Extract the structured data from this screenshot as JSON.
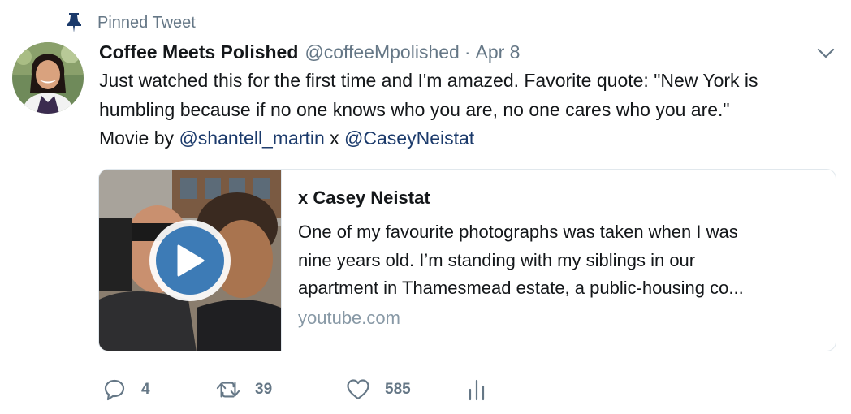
{
  "pinned": {
    "label": "Pinned Tweet",
    "icon": "pin-icon"
  },
  "author": {
    "display_name": "Coffee Meets Polished",
    "handle": "@coffeeMpolished",
    "separator": "·",
    "timestamp": "Apr 8"
  },
  "tweet": {
    "line1": "Just watched this for the first time and I'm amazed. Favorite quote: \"New York is",
    "line2": "humbling because if no one knows who you are, no one cares who you are.\"",
    "line3_prefix": "Movie by ",
    "mention1": "@shantell_martin",
    "line3_mid": " x ",
    "mention2": "@CaseyNeistat"
  },
  "card": {
    "title": "x Casey Neistat",
    "desc_line1": "One of my favourite photographs was taken when I was",
    "desc_line2": "nine years old. I’m standing with my siblings in our",
    "desc_line3": "apartment in Thamesmead estate, a public-housing co...",
    "domain": "youtube.com"
  },
  "actions": {
    "reply_count": "4",
    "retweet_count": "39",
    "like_count": "585"
  },
  "colors": {
    "text": "#14171a",
    "secondary": "#657786",
    "mention": "#1b3a6b",
    "border": "#e1e8ed",
    "play": "#3d7bb6"
  }
}
